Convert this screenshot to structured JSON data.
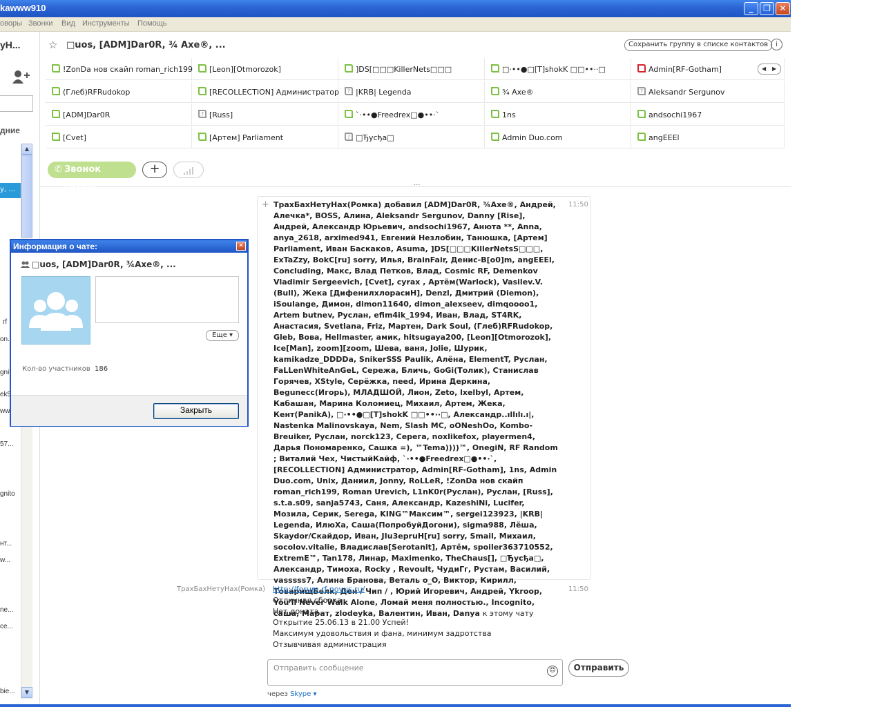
{
  "window": {
    "title": "kawww910"
  },
  "menu": [
    "оворы",
    "Звонки",
    "Вид",
    "Инструменты",
    "Помощь"
  ],
  "left": {
    "top_truncated": "уН...",
    "section_label": "дние",
    "frag_rf": "rf",
    "frag_on": "on...",
    "frag_gni": "gnit",
    "frag_ek5": "ek5",
    "frag_ww": "ww",
    "frag_57": "57...",
    "frag_gnito": "gnito",
    "frag_nt": "нт...",
    "frag_w": "w...",
    "frag_ne": "ne...",
    "frag_ce": "ce...",
    "frag_bie": "bie..."
  },
  "header": {
    "title": "□uos, [ADM]Dar0R, ¾ Axe®, ...",
    "save_group": "Сохранить группу в списке контактов",
    "call_group": "Звонок группе",
    "participants": [
      [
        "!ZonDa нов скайп roman_rich199",
        "[Leon][Otmorozok]",
        "]DS[□□□KillerNets□□□",
        "□·••●□[T]shokK □□••··□",
        "Admin[RF-Gotham]"
      ],
      [
        "(Глеб)RFRudokop",
        "[RECOLLECTION] Администратор",
        "|KRB| Legenda",
        "¾ Axe®",
        "Aleksandr Sergunov"
      ],
      [
        "[ADM]Dar0R",
        "[Russ]",
        "`·••●Freedrex□●••·`",
        "1ns",
        "andsochi1967"
      ],
      [
        "[Cvet]",
        "[Артем] Parliament",
        "□Ђусђа□",
        "Admin Duo.com",
        "angEEEl"
      ]
    ],
    "status": [
      [
        "online",
        "online",
        "online",
        "online",
        "offline-red"
      ],
      [
        "online",
        "online",
        "unknown",
        "online",
        "unknown"
      ],
      [
        "online",
        "unknown",
        "online",
        "online",
        "online"
      ],
      [
        "online",
        "online",
        "unknown",
        "online",
        "online"
      ]
    ],
    "more_dots": "..."
  },
  "chat": {
    "msg1_time": "11:50",
    "msg1_text": "ТрахБахНетуНах(Ромка) добавил [ADM]Dar0R, ¾Axe®, Андрей, Алечка*, BOSS, Алина, Aleksandr Sergunov, Danny [Rise], Андрей, Александр Юрьевич, andsochi1967, Анюта **, Anna, anya_2618, arximed941, Евгений Незлобин, Танюшка, [Артем] Parliament, Иван Баскаков, Asuma, ]DS[□□□KillerNetsS□□□, ExTaZzy, BokC[ru] sorry, Илья, BrainFair, Денис-B[o0]m, angEEEl, Concluding, Макс, Влад Петков, Влад, Cosmic RF, Demenkov Vladimir Sergeevich, [Cvet], cyrax , Артём(Warlock), Vasilev.V.(Bull), Жека [ДифенилхлорасиН], Denzl, Дмитрий (Diemon), iSoulange, Димон, dimon11640, dimon_alexseev, dimqoooo1, Artem butnev, Руслан, efim4ik_1994, Иван, Влад, ST4RK, Анастасия, Svetlana, Friz, Мартен, Dark Soul, (Глеб)RFRudokop, Gleb, Вова, Hellmaster, амик, hitsugaya200, [Leon][Otmorozok], Ice[Man], zoom][zoom, Шева, ваня, Jolie, Шурик, kamikadze_DDDDa, SnikerSSS Paulik, Алёна, ElementT, Руслан, FaLLenWhiteAnGeL, Сережа, Бличь, GoGi(Толик), Станислав Горячев, XStyle, Серёжка, need, Ирина Деркина, Begunecc(Игорь), МЛАДШОЙ, Лион, Zeto, lxelbyl, Артем, Кабашан, Марина Коломиец, Михаил, Артем, Жека, Кент(PanikA), □·••●□[T]shokK □□••··□, Александр..ıllılı.ı|, Nastenka Malinovskaya, Nem, Slash MC, oONeshOo, Kombo-Breuiker, Руслан, norck123, Серега, noxlikefox, playermen4, Дарья Пономаренко, Сашка =), ™Tema))))™, OnegiN, RF Random ; Виталий Чех, ЧистыйКайф, `·••●Freedrex□●••·`, [RECOLLECTION] Администратор, Admin[RF-Gotham], 1ns, Admin Duo.com, Unix, Даниил, Jonny, RoLLeR, !ZonDa нов скайп roman_rich199, Roman Urevich, L1nK0r(Руслан), Руслан, [Russ], s.t.a.s09, sanja5743, Саня, Александр, KazeshiNi, Lucifer, Мозила, Серик, Serega, KING™Максим™, sergei123923, |KRB| Legenda, ИлюХа, Саша(ПопробуйДогони), sigma988, Лёша, Skaydor/Скайдор, Иван, JIu3epruH[ru] sorry, Smail, Михаил, socolov.vitalie, Владислав[Serotanit], Артём, spoiler363710552, ExtremE™, Tan178, Линар, Maximenko, TheChaus[], □Ђусђа□, Александр, Тимоха, Rocky , Revoult, ЧудиГг, Рустам, Василий, vasssss7, Алина Бранова, Веталь o_O, Виктор, Кирилл, ТоварищБелк, Ден / Чип / , Юрий Игоревич, Андрей, Ykroop, You'll Never Walk Alone, Ломай меня полностью., Incognito, саша, Марат, zlodeyka, Валентин, Иван, Danya",
    "msg1_suffix": "к этому чату",
    "msg2_sender": "ТрахБахНетуНах(Ромка)",
    "msg2_time": "11:50",
    "msg2_lines": [
      "http://forum.rf-novus.ru/",
      "Отличная сборка",
      "Нет доната",
      "Открытие 25.06.13 в 21.00 Успей!",
      "Максимум удовольствия и фана, минимум задротства",
      "Отзывчивая администрация"
    ],
    "input_placeholder": "Отправить сообщение",
    "send_label": "Отправить",
    "via_label": "через",
    "via_service": "Skype"
  },
  "dialog": {
    "title": "Информация о чате:",
    "group_name": "□uos, [ADM]Dar0R, ¾Axe®, ...",
    "more_label": "Еще",
    "count_label": "Кол-во участников",
    "count_value": "186",
    "close_label": "Закрыть"
  },
  "colors": {
    "online": "#7cc142",
    "offline": "#d9232d",
    "unknown": "#999999",
    "link": "#1a6ec2",
    "call_button": "#bfe08e"
  }
}
